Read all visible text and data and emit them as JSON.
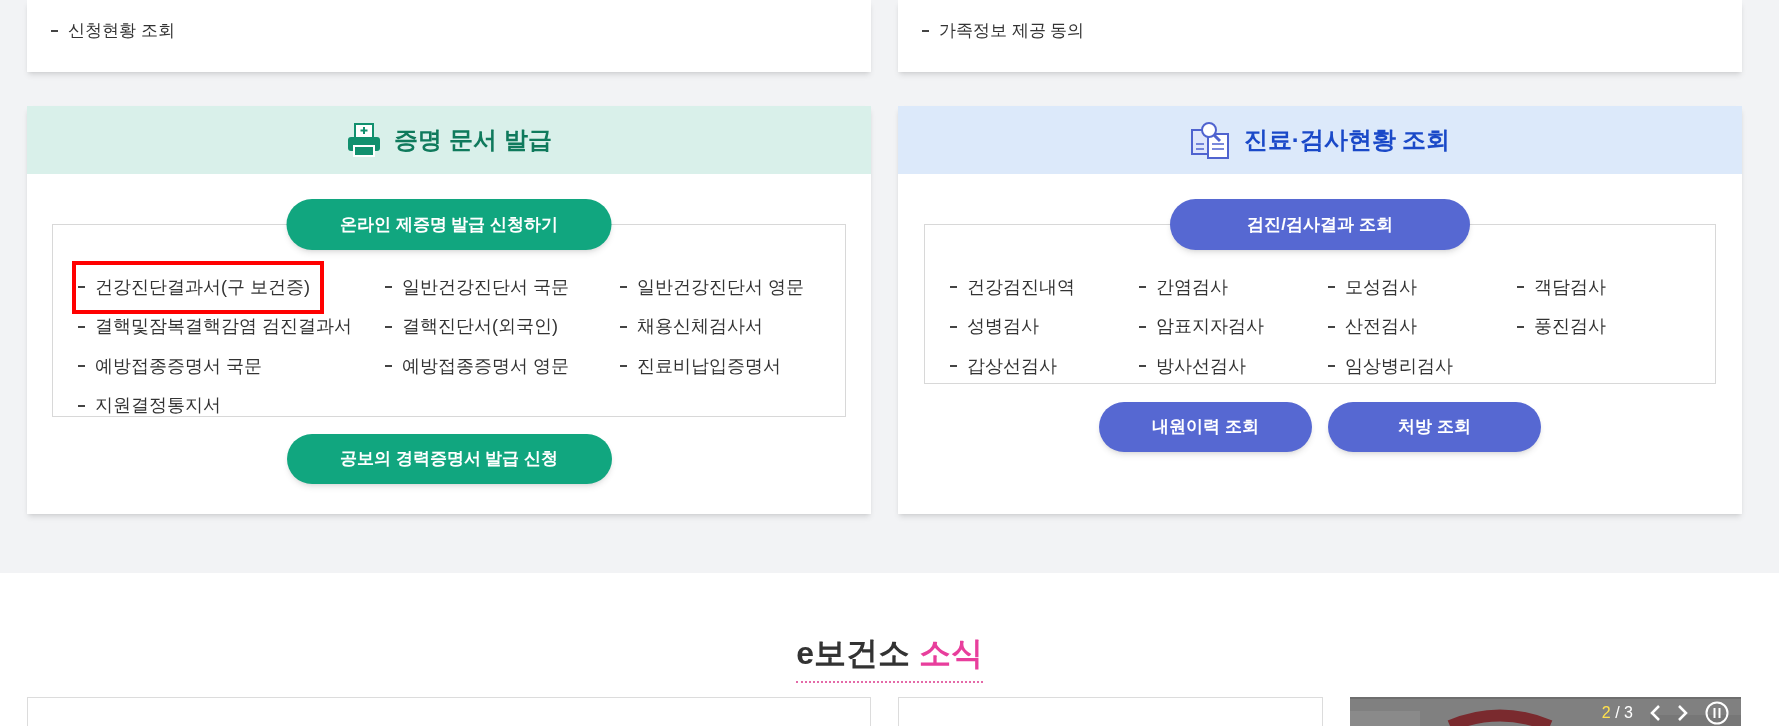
{
  "top_cards": [
    {
      "items": [
        "신청현황 조회"
      ]
    },
    {
      "items": [
        "가족정보 제공 동의"
      ]
    }
  ],
  "certificate_card": {
    "title": "증명 문서 발급",
    "main_button": "온라인 제증명 발급 신청하기",
    "items": [
      {
        "label": "건강진단결과서(구 보건증)",
        "highlighted": true
      },
      {
        "label": "일반건강진단서 국문",
        "highlighted": false
      },
      {
        "label": "일반건강진단서 영문",
        "highlighted": false
      },
      {
        "label": "결핵및잠복결핵감염 검진결과서",
        "highlighted": false
      },
      {
        "label": "결핵진단서(외국인)",
        "highlighted": false
      },
      {
        "label": "채용신체검사서",
        "highlighted": false
      },
      {
        "label": "예방접종증명서 국문",
        "highlighted": false
      },
      {
        "label": "예방접종증명서 영문",
        "highlighted": false
      },
      {
        "label": "진료비납입증명서",
        "highlighted": false
      },
      {
        "label": "지원결정통지서",
        "highlighted": false
      }
    ],
    "bottom_button": "공보의 경력증명서 발급 신청"
  },
  "inquiry_card": {
    "title": "진료·검사현황 조회",
    "main_button": "검진/검사결과 조회",
    "items": [
      "건강검진내역",
      "간염검사",
      "모성검사",
      "객담검사",
      "성병검사",
      "암표지자검사",
      "산전검사",
      "풍진검사",
      "갑상선검사",
      "방사선검사",
      "임상병리검사"
    ],
    "bottom_buttons": [
      "내원이력 조회",
      "처방 조회"
    ]
  },
  "news": {
    "title_main": "e보건소",
    "title_accent": "소식",
    "slider": {
      "current": "2",
      "separator": "/",
      "total": "3"
    }
  }
}
